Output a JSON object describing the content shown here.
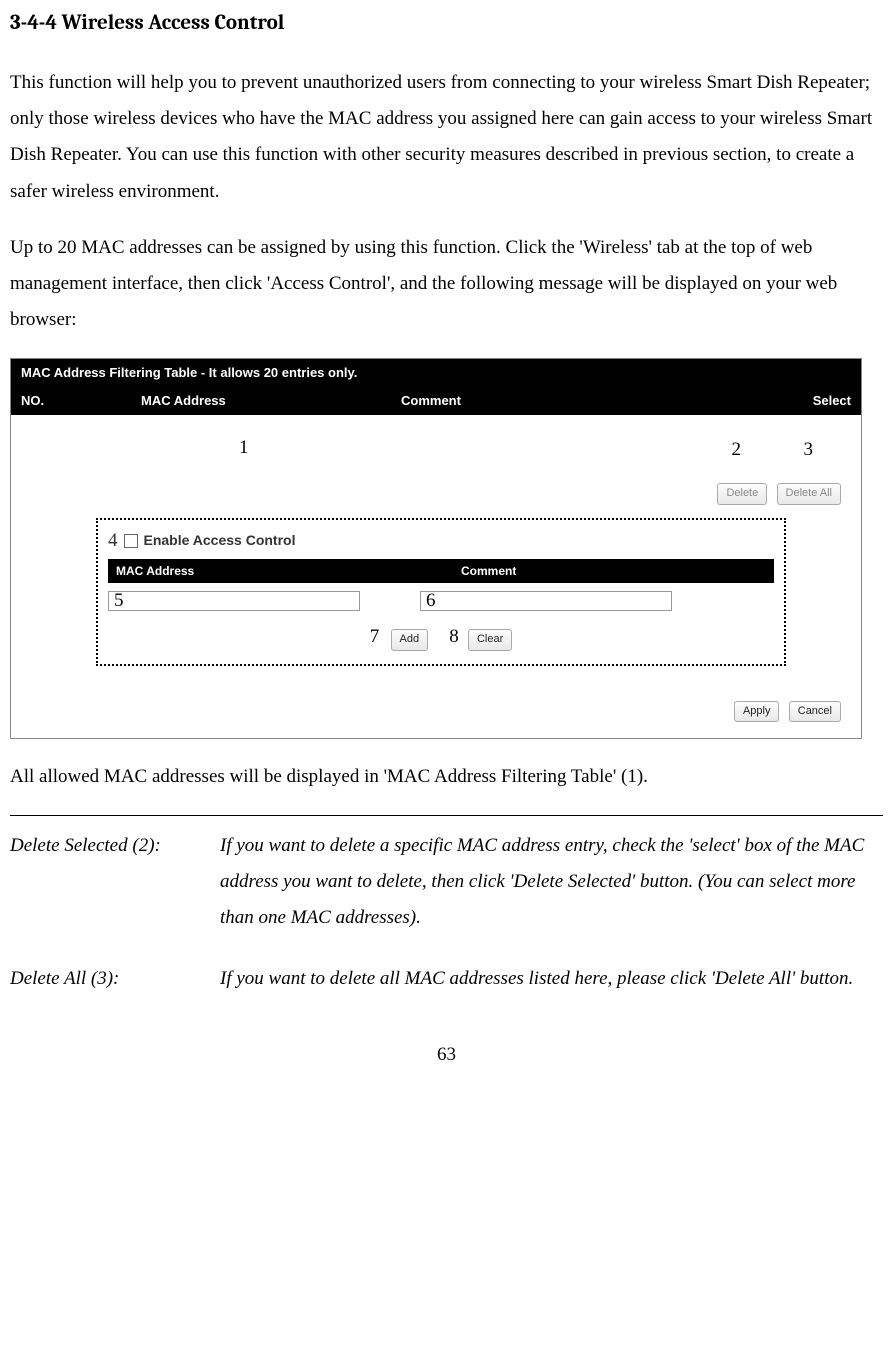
{
  "heading": "3-4-4 Wireless Access Control",
  "paragraph1": "This function will help you to prevent unauthorized users from connecting to your wireless Smart Dish Repeater; only those wireless devices who have the MAC address you assigned here can gain access to your wireless Smart Dish Repeater. You can use this function with other security measures described in previous section, to create a safer wireless environment.",
  "paragraph2": "Up to 20 MAC addresses can be assigned by using this function. Click the 'Wireless' tab at the top of web management interface, then click 'Access Control', and the following message will be displayed on your web browser:",
  "ui": {
    "title_bar": "MAC Address Filtering Table - It allows 20 entries only.",
    "headers": {
      "no": "NO.",
      "mac": "MAC Address",
      "comment": "Comment",
      "select": "Select"
    },
    "buttons": {
      "delete": "Delete",
      "delete_all": "Delete All",
      "add": "Add",
      "clear": "Clear",
      "apply": "Apply",
      "cancel": "Cancel"
    },
    "enable_label": "Enable Access Control",
    "sub_headers": {
      "mac": "MAC Address",
      "comment": "Comment"
    }
  },
  "callouts": {
    "c1": "1",
    "c2": "2",
    "c3": "3",
    "c4": "4",
    "c5": "5",
    "c6": "6",
    "c7": "7",
    "c8": "8"
  },
  "after_ss": "All allowed MAC addresses will be displayed in 'MAC Address Filtering Table' (1).",
  "defs": {
    "d2_label": "Delete Selected (2):",
    "d2_text": "If you want to delete a specific MAC address entry, check the 'select' box of the MAC address you want to delete, then click 'Delete Selected' button. (You can select more than one MAC addresses).",
    "d3_label": "Delete All (3):",
    "d3_text": "If you want to delete all MAC addresses listed here, please click 'Delete All' button."
  },
  "page_number": "63"
}
